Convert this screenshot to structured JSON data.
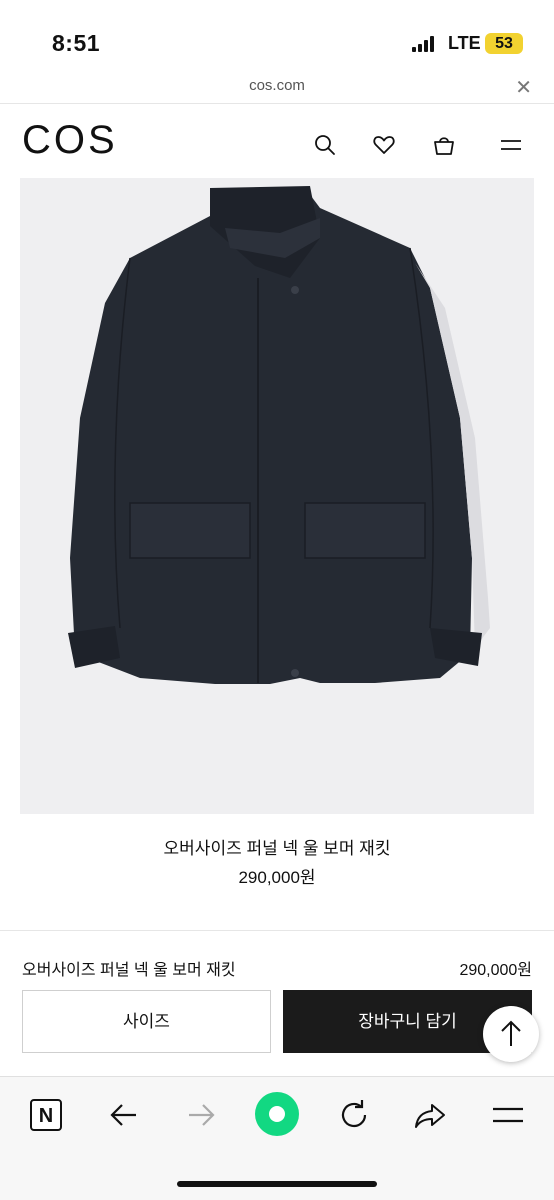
{
  "status_bar": {
    "time": "8:51",
    "network": "LTE",
    "battery": "53"
  },
  "address_bar": {
    "url": "cos.com",
    "close_glyph": "✕"
  },
  "site": {
    "logo": "COS",
    "icons": [
      "search-icon",
      "heart-icon",
      "bag-icon",
      "menu-icon"
    ]
  },
  "product": {
    "image": "dark navy oversized jacket",
    "title": "오버사이즈 퍼널 넥 울 보머 재킷",
    "price": "290,000원"
  },
  "sticky_bar": {
    "title": "오버사이즈 퍼널 넥 울 보머 재킷",
    "price": "290,000원",
    "size_label": "사이즈",
    "cart_label": "장바구니 담기"
  },
  "toolbar": {
    "logo_letter": "N",
    "icons": [
      "naver-icon",
      "back-arrow-icon",
      "forward-arrow-icon",
      "green-dot-icon",
      "reload-icon",
      "share-icon",
      "menu-icon"
    ]
  },
  "colors": {
    "brand_green": "#12d882",
    "button_dark": "#1b1b1b",
    "jacket": "#252a33"
  }
}
